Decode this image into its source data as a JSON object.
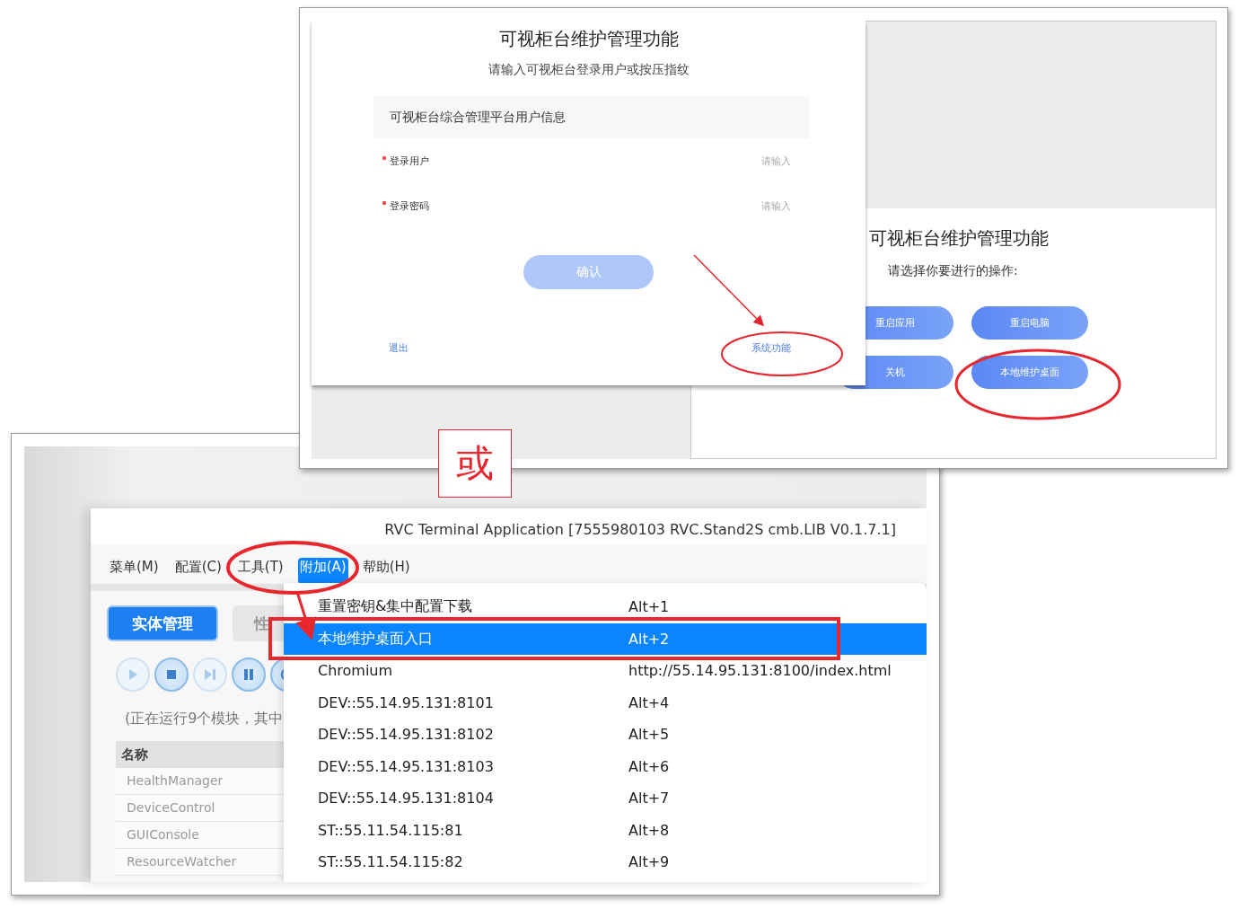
{
  "login_screen": {
    "title": "可视柜台维护管理功能",
    "subtitle": "请输入可视柜台登录用户或按压指纹",
    "section_title": "可视柜台综合管理平台用户信息",
    "fields": [
      {
        "label": "登录用户",
        "required": true,
        "placeholder": "请输入"
      },
      {
        "label": "登录密码",
        "required": true,
        "placeholder": "请输入"
      }
    ],
    "confirm_button": {
      "label": "确认",
      "disabled": true
    },
    "exit_link": "退出",
    "system_link": "系统功能"
  },
  "maintenance_screen": {
    "title": "可视柜台维护管理功能",
    "prompt": "请选择你要进行的操作:",
    "buttons": [
      "重启应用",
      "重启电脑",
      "关机",
      "本地维护桌面"
    ]
  },
  "or_label": "或",
  "terminal_app": {
    "title": "RVC Terminal Application [7555980103 RVC.Stand2S cmb.LIB V0.1.7.1]",
    "menu": [
      {
        "label": "菜单(M)",
        "selected": false
      },
      {
        "label": "配置(C)",
        "selected": false
      },
      {
        "label": "工具(T)",
        "selected": false
      },
      {
        "label": "附加(A)",
        "selected": true
      },
      {
        "label": "帮助(H)",
        "selected": false
      }
    ],
    "tabs": [
      {
        "label": "实体管理",
        "selected": true
      },
      {
        "label": "性",
        "selected": false
      }
    ],
    "toolbar": [
      {
        "kind": "play",
        "disabled": true
      },
      {
        "kind": "stop",
        "disabled": false
      },
      {
        "kind": "next",
        "disabled": true
      },
      {
        "kind": "pause",
        "disabled": false
      },
      {
        "kind": "other",
        "disabled": false
      }
    ],
    "status_text": "(正在运行9个模块，其中",
    "table": {
      "columns": [
        "名称"
      ],
      "rows": [
        "HealthManager",
        "DeviceControl",
        "GUIConsole",
        "ResourceWatcher"
      ]
    },
    "dropdown": [
      {
        "label": "重置密钥&集中配置下载",
        "shortcut": "Alt+1",
        "selected": false
      },
      {
        "label": "本地维护桌面入口",
        "shortcut": "Alt+2",
        "selected": true
      },
      {
        "label": "Chromium",
        "shortcut": "http://55.14.95.131:8100/index.html",
        "selected": false
      },
      {
        "label": "DEV::55.14.95.131:8101",
        "shortcut": "Alt+4",
        "selected": false
      },
      {
        "label": "DEV::55.14.95.131:8102",
        "shortcut": "Alt+5",
        "selected": false
      },
      {
        "label": "DEV::55.14.95.131:8103",
        "shortcut": "Alt+6",
        "selected": false
      },
      {
        "label": "DEV::55.14.95.131:8104",
        "shortcut": "Alt+7",
        "selected": false
      },
      {
        "label": "ST::55.11.54.115:81",
        "shortcut": "Alt+8",
        "selected": false
      },
      {
        "label": "ST::55.11.54.115:82",
        "shortcut": "Alt+9",
        "selected": false
      }
    ]
  }
}
